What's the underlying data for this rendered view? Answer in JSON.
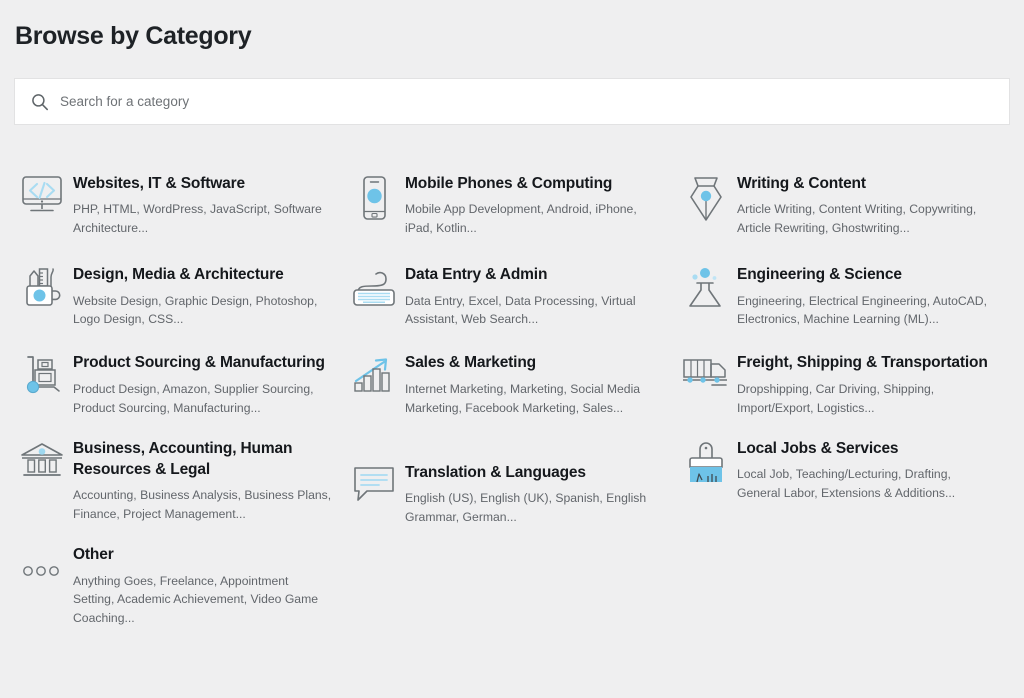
{
  "header": {
    "title": "Browse by Category"
  },
  "search": {
    "placeholder": "Search for a category",
    "value": "",
    "icon": "search-icon"
  },
  "colors": {
    "page_background": "#efeff0",
    "search_background": "#ffffff",
    "search_border": "#e2e2e3",
    "title_text": "#1e2226",
    "category_title_text": "#15181c",
    "category_subtitle_text": "#62666b",
    "icon_outline": "#6f7579",
    "icon_accent": "#5bbbe8",
    "icon_accent_light": "#bfe4f5"
  },
  "columns": [
    {
      "items": [
        {
          "icon": "monitor-code-icon",
          "title": "Websites, IT & Software",
          "subtitle": "PHP, HTML, WordPress, JavaScript, Software Architecture..."
        },
        {
          "icon": "design-mug-tools-icon",
          "title": "Design, Media & Architecture",
          "subtitle": "Website Design, Graphic Design, Photoshop, Logo Design, CSS..."
        },
        {
          "icon": "hand-truck-boxes-icon",
          "title": "Product Sourcing & Manufacturing",
          "subtitle": "Product Design, Amazon, Supplier Sourcing, Product Sourcing, Manufacturing..."
        },
        {
          "icon": "bank-building-icon",
          "title": "Business, Accounting, Human Resources & Legal",
          "subtitle": "Accounting, Business Analysis, Business Plans, Finance, Project Management..."
        },
        {
          "icon": "three-dots-icon",
          "title": "Other",
          "subtitle": "Anything Goes, Freelance, Appointment Setting, Academic Achievement, Video Game Coaching..."
        }
      ]
    },
    {
      "items": [
        {
          "icon": "smartphone-icon",
          "title": "Mobile Phones & Computing",
          "subtitle": "Mobile App Development, Android, iPhone, iPad, Kotlin..."
        },
        {
          "icon": "keyboard-icon",
          "title": "Data Entry & Admin",
          "subtitle": "Data Entry, Excel, Data Processing, Virtual Assistant, Web Search..."
        },
        {
          "icon": "growth-chart-icon",
          "title": "Sales & Marketing",
          "subtitle": "Internet Marketing, Marketing, Social Media Marketing, Facebook Marketing, Sales..."
        },
        {
          "icon": "speech-bubble-lines-icon",
          "title": "Translation & Languages",
          "subtitle": "English (US), English (UK), Spanish, English Grammar, German..."
        }
      ]
    },
    {
      "items": [
        {
          "icon": "pen-nib-icon",
          "title": "Writing & Content",
          "subtitle": "Article Writing, Content Writing, Copywriting, Article Rewriting, Ghostwriting..."
        },
        {
          "icon": "flask-icon",
          "title": "Engineering & Science",
          "subtitle": "Engineering, Electrical Engineering, AutoCAD, Electronics, Machine Learning (ML)..."
        },
        {
          "icon": "delivery-truck-icon",
          "title": "Freight, Shipping & Transportation",
          "subtitle": "Dropshipping, Car Driving, Shipping, Import/Export, Logistics..."
        },
        {
          "icon": "paintbrush-icon",
          "title": "Local Jobs & Services",
          "subtitle": "Local Job, Teaching/Lecturing, Drafting, General Labor, Extensions & Additions..."
        }
      ]
    }
  ]
}
